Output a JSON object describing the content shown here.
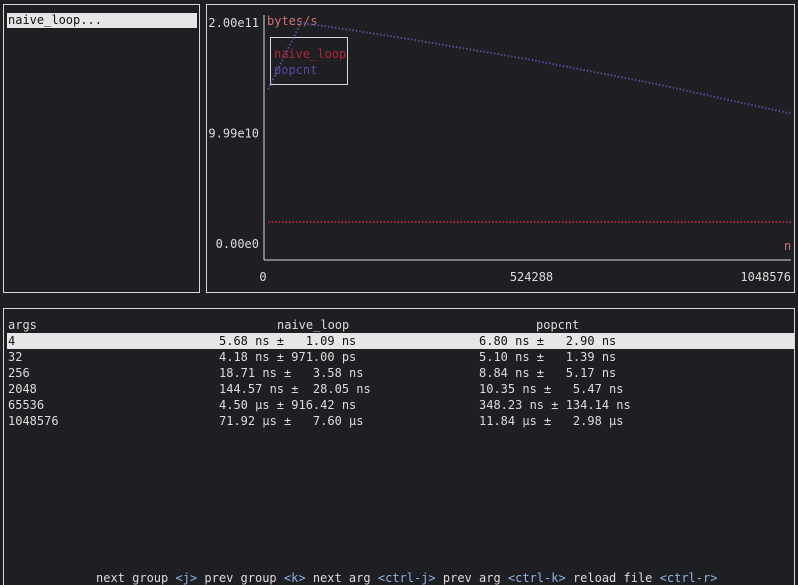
{
  "groups": {
    "items": [
      "naive_loop..."
    ]
  },
  "chart": {
    "ylabel": "bytes/s",
    "yticks": [
      "2.00e11",
      "9.99e10",
      "0.00e0"
    ],
    "xticks": [
      "0",
      "524288",
      "1048576"
    ],
    "legend": [
      "naive_loop",
      "popcnt"
    ],
    "edge_label": "n",
    "colors": {
      "naive_loop": "#b4243c",
      "popcnt": "#5a4a9a",
      "axis": "#d8d8d8"
    }
  },
  "chart_data": {
    "type": "scatter",
    "ylabel": "bytes/s",
    "xlim": [
      0,
      1048576
    ],
    "ylim": [
      0,
      200000000000.0
    ],
    "series": [
      {
        "name": "naive_loop",
        "x": [
          0,
          1048576
        ],
        "y": [
          20000000000.0,
          20000000000.0
        ]
      },
      {
        "name": "popcnt",
        "x": [
          0,
          65536,
          131072,
          262144,
          524288,
          786432,
          1048576
        ],
        "y": [
          140000000000.0,
          200000000000.0,
          196000000000.0,
          187000000000.0,
          167000000000.0,
          144000000000.0,
          118000000000.0
        ]
      }
    ]
  },
  "table": {
    "headers": [
      "args",
      "naive_loop",
      "popcnt"
    ],
    "rows": [
      {
        "args": "4",
        "naive": "5.68 ns ±   1.09 ns",
        "popcnt": "6.80 ns ±   2.90 ns"
      },
      {
        "args": "32",
        "naive": "4.18 ns ± 971.00 ps",
        "popcnt": "5.10 ns ±   1.39 ns"
      },
      {
        "args": "256",
        "naive": "18.71 ns ±   3.58 ns",
        "popcnt": "8.84 ns ±   5.17 ns"
      },
      {
        "args": "2048",
        "naive": "144.57 ns ±  28.05 ns",
        "popcnt": "10.35 ns ±   5.47 ns"
      },
      {
        "args": "65536",
        "naive": "4.50 μs ± 916.42 ns",
        "popcnt": "348.23 ns ± 134.14 ns"
      },
      {
        "args": "1048576",
        "naive": "71.92 μs ±   7.60 μs",
        "popcnt": "11.84 μs ±   2.98 μs"
      }
    ]
  },
  "footer": [
    {
      "label": "next group",
      "key": "<j>"
    },
    {
      "label": "prev group",
      "key": "<k>"
    },
    {
      "label": "next arg",
      "key": "<ctrl-j>"
    },
    {
      "label": "prev arg",
      "key": "<ctrl-k>"
    },
    {
      "label": "reload file",
      "key": "<ctrl-r>"
    }
  ]
}
